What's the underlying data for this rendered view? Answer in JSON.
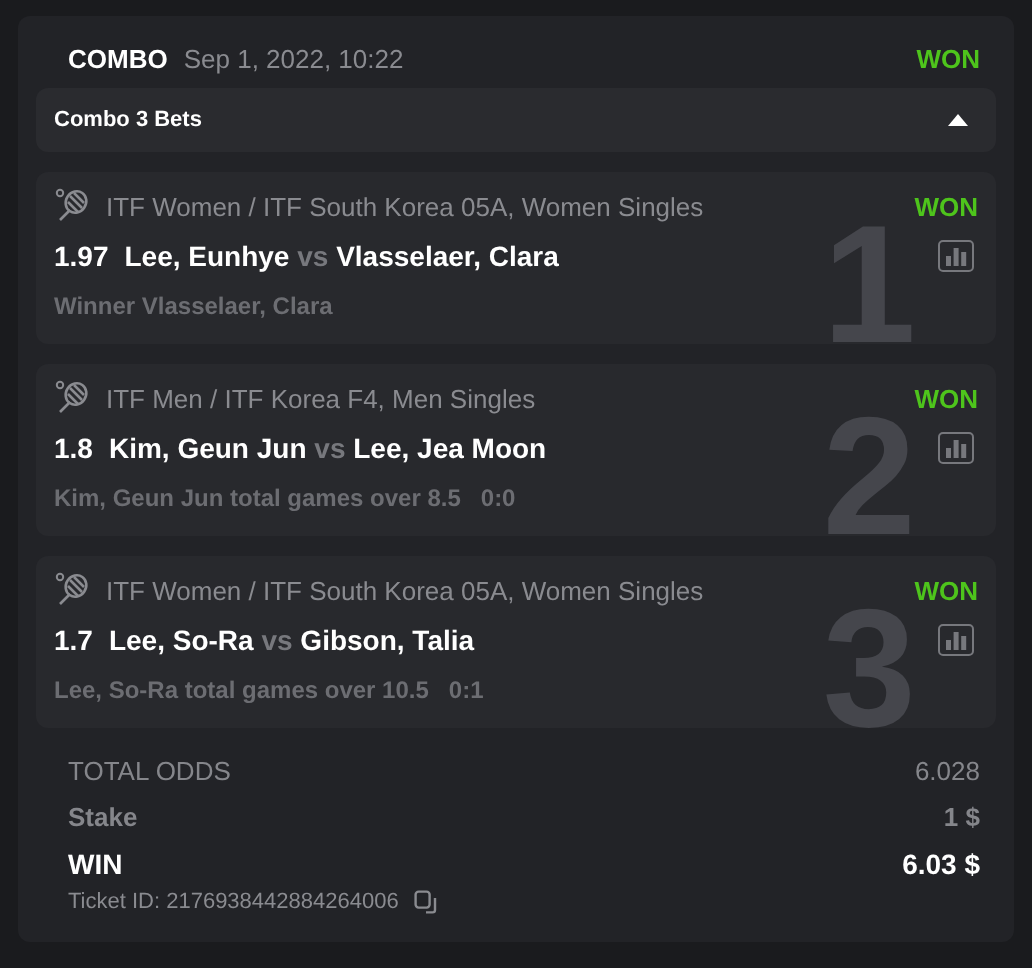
{
  "header": {
    "type": "COMBO",
    "date": "Sep 1, 2022, 10:22",
    "status": "WON"
  },
  "combo_bar": {
    "label": "Combo 3 Bets",
    "expanded": true
  },
  "bets": [
    {
      "kind": "tennis",
      "league": "ITF Women / ITF South Korea 05A, Women Singles",
      "status": "WON",
      "odds": "1.97",
      "home": "Lee, Eunhye",
      "vs": "vs",
      "away": "Vlasselaer, Clara",
      "pick": "Winner Vlasselaer, Clara",
      "number": "1"
    },
    {
      "kind": "tennis",
      "league": "ITF Men / ITF Korea F4, Men Singles",
      "status": "WON",
      "odds": "1.8",
      "home": "Kim, Geun Jun",
      "vs": "vs",
      "away": "Lee, Jea Moon",
      "pick": "Kim, Geun Jun total games over 8.5",
      "score": "0:0",
      "number": "2"
    },
    {
      "kind": "tennis",
      "league": "ITF Women / ITF South Korea 05A, Women Singles",
      "status": "WON",
      "odds": "1.7",
      "home": "Lee, So-Ra",
      "vs": "vs",
      "away": "Gibson, Talia",
      "pick": "Lee, So-Ra total games over 10.5",
      "score": "0:1",
      "number": "3"
    }
  ],
  "summary": [
    {
      "kind": "odds",
      "label": "TOTAL ODDS",
      "value": "6.028"
    },
    {
      "kind": "stake",
      "label": "Stake",
      "value": "1 $"
    },
    {
      "kind": "win",
      "label": "WIN",
      "value": "6.03 $"
    }
  ],
  "ticket_id": "Ticket ID: 2176938442884264006"
}
